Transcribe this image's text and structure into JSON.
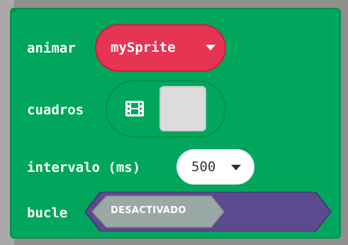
{
  "block": {
    "animate_label": "animar",
    "frames_label": "cuadros",
    "interval_label": "intervalo (ms)",
    "loop_label": "bucle",
    "color": "#00a65c"
  },
  "sprite_dropdown": {
    "value": "mySprite",
    "color": "#e63553",
    "icon": "caret-down-icon"
  },
  "frames_editor": {
    "icon": "film-icon",
    "frame_color": "#dcdcdc"
  },
  "interval_dropdown": {
    "value": "500",
    "icon": "caret-down-icon"
  },
  "loop_toggle": {
    "value": "DESACTIVADO",
    "off_color": "#9aa8a6",
    "track_color": "#5c4a8f"
  }
}
